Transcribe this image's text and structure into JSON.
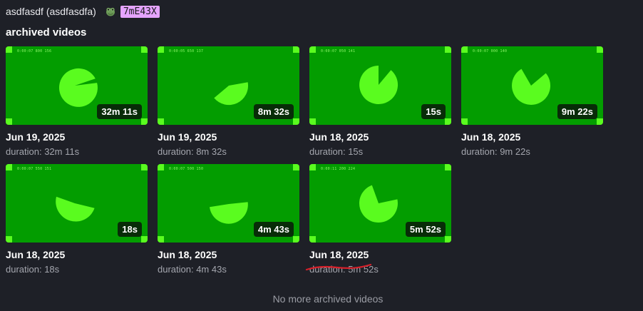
{
  "header": {
    "user_display": "asdfasdf (asdfasdfa)",
    "icon": "frog-icon",
    "code": "7mE43X",
    "code_color": "#e5a4ff"
  },
  "section_title": "archived videos",
  "colors": {
    "background": "#1e2027",
    "thumb_green": "#039d00",
    "shape_green": "#5afc1f"
  },
  "videos": [
    {
      "date": "Jun 19, 2025",
      "duration_label": "duration: 32m 11s",
      "badge": "32m 11s",
      "timecode": "0:00:07 800 156"
    },
    {
      "date": "Jun 19, 2025",
      "duration_label": "duration: 8m 32s",
      "badge": "8m 32s",
      "timecode": "0:00:05 650 137"
    },
    {
      "date": "Jun 18, 2025",
      "duration_label": "duration: 15s",
      "badge": "15s",
      "timecode": "0:00:07 050 141"
    },
    {
      "date": "Jun 18, 2025",
      "duration_label": "duration: 9m 22s",
      "badge": "9m 22s",
      "timecode": "0:00:07 000 140"
    },
    {
      "date": "Jun 18, 2025",
      "duration_label": "duration: 18s",
      "badge": "18s",
      "timecode": "0:00:07 550 151"
    },
    {
      "date": "Jun 18, 2025",
      "duration_label": "duration: 4m 43s",
      "badge": "4m 43s",
      "timecode": "0:00:07 500 150"
    },
    {
      "date": "Jun 18, 2025",
      "duration_label": "duration: 5m 52s",
      "badge": "5m 52s",
      "timecode": "0:00:11 200 224"
    }
  ],
  "footer": "No more archived videos"
}
